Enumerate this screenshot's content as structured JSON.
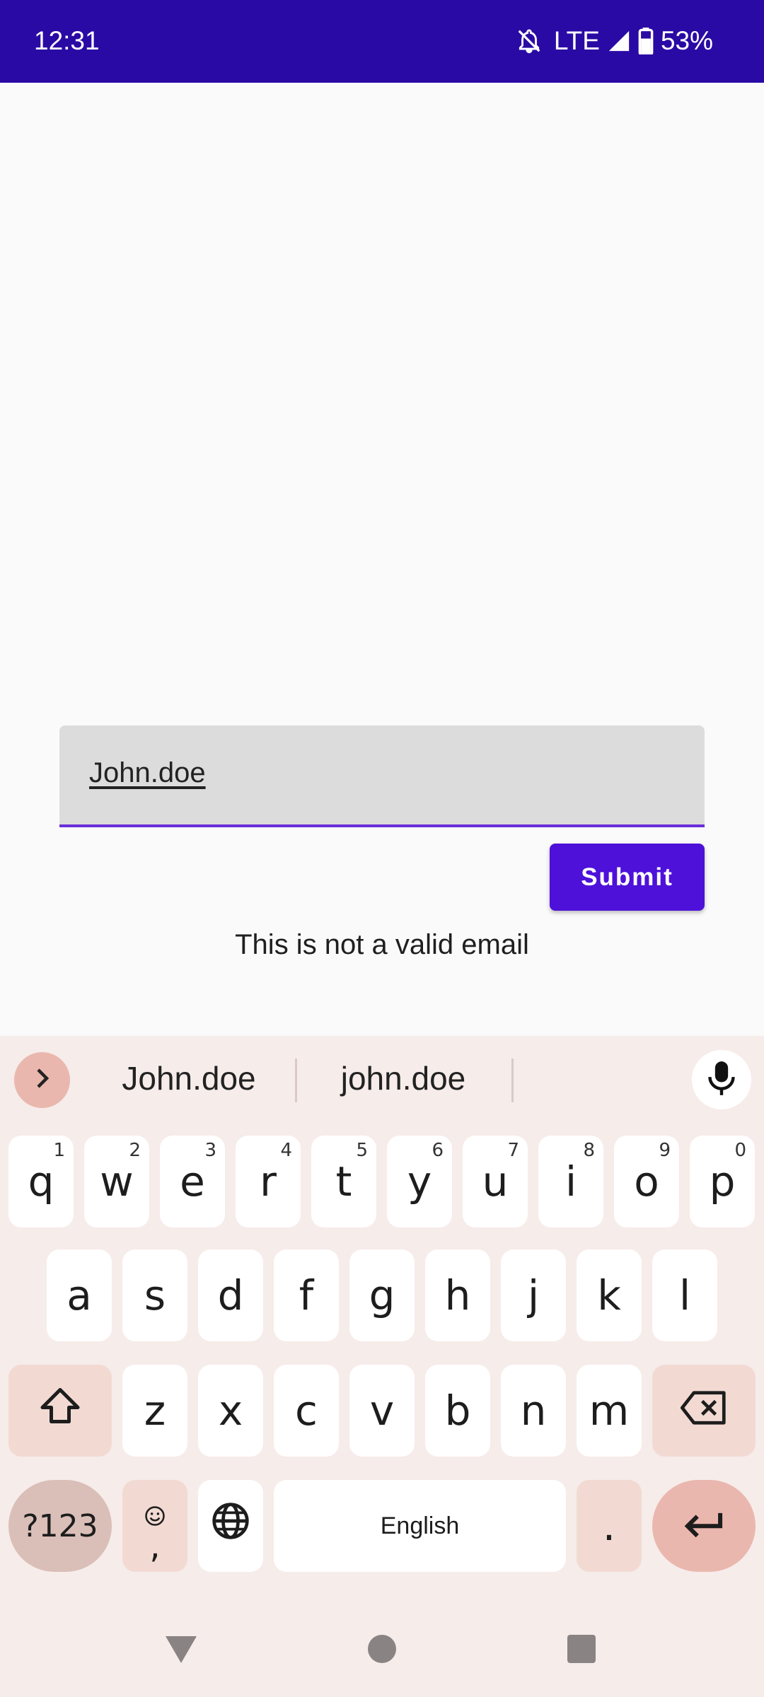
{
  "status_bar": {
    "time": "12:31",
    "network": "LTE",
    "battery": "53%"
  },
  "form": {
    "email_value": "John.doe",
    "submit_label": "Submit",
    "error_message": "This is not a valid email"
  },
  "keyboard": {
    "suggestions": [
      "John.doe",
      "john.doe"
    ],
    "row1": [
      {
        "key": "q",
        "hint": "1"
      },
      {
        "key": "w",
        "hint": "2"
      },
      {
        "key": "e",
        "hint": "3"
      },
      {
        "key": "r",
        "hint": "4"
      },
      {
        "key": "t",
        "hint": "5"
      },
      {
        "key": "y",
        "hint": "6"
      },
      {
        "key": "u",
        "hint": "7"
      },
      {
        "key": "i",
        "hint": "8"
      },
      {
        "key": "o",
        "hint": "9"
      },
      {
        "key": "p",
        "hint": "0"
      }
    ],
    "row2": [
      "a",
      "s",
      "d",
      "f",
      "g",
      "h",
      "j",
      "k",
      "l"
    ],
    "row3": [
      "z",
      "x",
      "c",
      "v",
      "b",
      "n",
      "m"
    ],
    "symbols_label": "?123",
    "comma_label": ",",
    "space_label": "English",
    "period_label": "."
  },
  "colors": {
    "accent": "#4E11D9",
    "status_bar": "#2A0AA4",
    "underline": "#6A2FD8"
  },
  "icons": [
    "mute-icon",
    "signal-icon",
    "battery-icon",
    "chevron-right-icon",
    "mic-icon",
    "shift-icon",
    "backspace-icon",
    "emoji-icon",
    "globe-icon",
    "enter-icon",
    "back-nav-icon",
    "home-nav-icon",
    "recents-nav-icon"
  ]
}
